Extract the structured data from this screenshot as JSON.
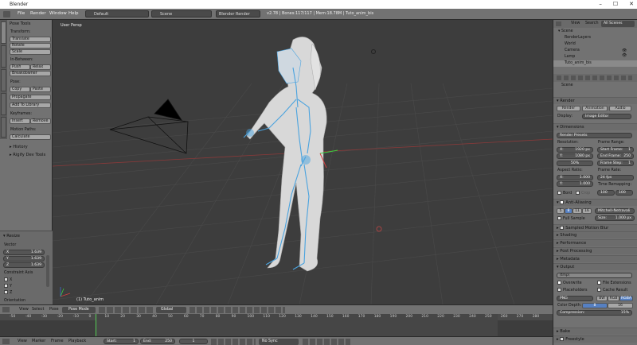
{
  "window": {
    "title": "Blender",
    "min": "–",
    "max": "☐",
    "close": "✕"
  },
  "info_header": {
    "menus": [
      "File",
      "Render",
      "Window",
      "Help"
    ],
    "layout": "Default",
    "scene": "Scene",
    "engine": "Blender Render",
    "stats": "v2.78 | Bones:117/117 | Mem:18.78M | Tuto_anim_bis"
  },
  "tool_shelf": {
    "tabs": [
      "Tools",
      "Create",
      "Relations",
      "Grease Pencil",
      "Rigify"
    ],
    "header": "Pose Tools",
    "transform_label": "Transform:",
    "translate": "Translate",
    "rotate": "Rotate",
    "scale": "Scale",
    "inbetween_label": "In-Between:",
    "push": "Push",
    "relax": "Relax",
    "breakdowner": "Breakdowner",
    "pose_label": "Pose:",
    "copy": "Copy",
    "paste": "Paste",
    "propagate": "Propagate",
    "add_library": "Add To Library",
    "keyframes_label": "Keyframes:",
    "insert": "Insert",
    "remove": "Remove",
    "motion_paths_label": "Motion Paths:",
    "calculate": "Calculate",
    "history": "History",
    "rigify": "Rigify Dev Tools",
    "resize_header": "Resize",
    "vector_label": "Vector",
    "vx": "X",
    "vx_val": "1.639",
    "vy": "Y",
    "vy_val": "1.639",
    "vz": "Z",
    "vz_val": "1.639",
    "constraint_label": "Constraint Axis",
    "cx": "X",
    "cy": "Y",
    "cz": "Z",
    "orientation": "Orientation"
  },
  "viewport": {
    "label": "User Persp",
    "object": "(1) Tuto_anim"
  },
  "outliner": {
    "view": "View",
    "search": "Search",
    "all_scenes": "All Scenes",
    "items": [
      "Scene",
      "RenderLayers",
      "World",
      "Camera",
      "Lamp",
      "Tuto_anim_bis"
    ]
  },
  "properties": {
    "scene": "Scene",
    "render_header": "Render",
    "render_btn": "Render",
    "animation_btn": "Animation",
    "audio_btn": "Audio",
    "display_label": "Display:",
    "display_val": "Image Editor",
    "dimensions_header": "Dimensions",
    "render_presets": "Render Presets",
    "resolution_label": "Resolution:",
    "res_x": "X:",
    "res_x_val": "1920 px",
    "res_y": "Y:",
    "res_y_val": "1080 px",
    "res_pct": "50%",
    "frame_range_label": "Frame Range:",
    "start_frame": "Start Frame:",
    "start_val": "1",
    "end_frame": "End Frame:",
    "end_val": "250",
    "frame_step": "Frame Step:",
    "step_val": "1",
    "aspect_label": "Aspect Ratio:",
    "asp_x": "X:",
    "asp_x_val": "1.000",
    "asp_y": "Y:",
    "asp_y_val": "1.000",
    "frame_rate_label": "Frame Rate:",
    "fps": "24 fps",
    "time_remap_label": "Time Remapping:",
    "tr_old": "100",
    "tr_new": "100",
    "border": "Bord",
    "crop": "Crop",
    "aa_header": "Anti-Aliasing",
    "aa_5": "5",
    "aa_8": "8",
    "aa_11": "11",
    "aa_16": "16",
    "aa_filter": "Mitchell-Netravali",
    "full_sample": "Full Sample",
    "aa_size": "Size:",
    "aa_size_val": "1.000 px",
    "motion_blur": "Sampled Motion Blur",
    "shading": "Shading",
    "performance": "Performance",
    "post_processing": "Post Processing",
    "metadata": "Metadata",
    "output_header": "Output",
    "output_path": "/tmp\\",
    "overwrite": "Overwrite",
    "file_ext": "File Extensions",
    "placeholders": "Placeholders",
    "cache_result": "Cache Result",
    "format": "PNG",
    "bw": "BW",
    "rgb": "RGB",
    "rgba": "RGBA",
    "color_depth": "Color Depth:",
    "depth_8": "8",
    "depth_16": "16",
    "compression": "Compression:",
    "compression_val": "15%",
    "bake": "Bake",
    "freestyle": "Freestyle"
  },
  "view3d_header": {
    "view": "View",
    "select": "Select",
    "pose": "Pose",
    "mode": "Pose Mode",
    "orientation": "Global"
  },
  "timeline": {
    "ticks": [
      "-50",
      "-40",
      "-30",
      "-20",
      "-10",
      "0",
      "10",
      "20",
      "30",
      "40",
      "50",
      "60",
      "70",
      "80",
      "90",
      "100",
      "110",
      "120",
      "130",
      "140",
      "150",
      "160",
      "170",
      "180",
      "190",
      "200",
      "210",
      "220",
      "230",
      "240",
      "250",
      "260",
      "270",
      "280"
    ],
    "view": "View",
    "marker": "Marker",
    "frame": "Frame",
    "playback": "Playback",
    "start": "Start:",
    "start_val": "1",
    "end": "End:",
    "end_val": "250",
    "current": "1",
    "sync": "No Sync"
  },
  "colors": {
    "accent": "#5680c2",
    "bone": "#4aa3df",
    "grid": "#4a4a4a"
  }
}
